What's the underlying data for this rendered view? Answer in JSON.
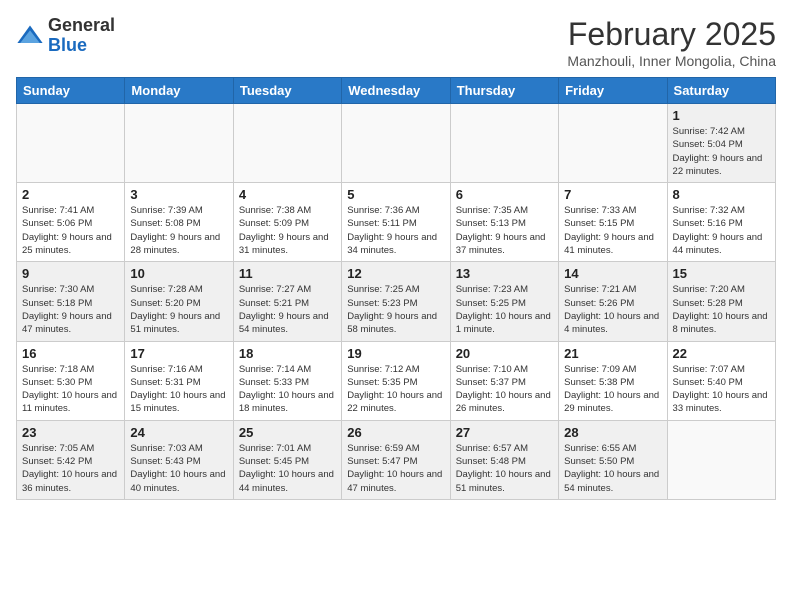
{
  "logo": {
    "general": "General",
    "blue": "Blue"
  },
  "title": "February 2025",
  "location": "Manzhouli, Inner Mongolia, China",
  "weekdays": [
    "Sunday",
    "Monday",
    "Tuesday",
    "Wednesday",
    "Thursday",
    "Friday",
    "Saturday"
  ],
  "weeks": [
    [
      {
        "day": "",
        "info": ""
      },
      {
        "day": "",
        "info": ""
      },
      {
        "day": "",
        "info": ""
      },
      {
        "day": "",
        "info": ""
      },
      {
        "day": "",
        "info": ""
      },
      {
        "day": "",
        "info": ""
      },
      {
        "day": "1",
        "info": "Sunrise: 7:42 AM\nSunset: 5:04 PM\nDaylight: 9 hours and 22 minutes."
      }
    ],
    [
      {
        "day": "2",
        "info": "Sunrise: 7:41 AM\nSunset: 5:06 PM\nDaylight: 9 hours and 25 minutes."
      },
      {
        "day": "3",
        "info": "Sunrise: 7:39 AM\nSunset: 5:08 PM\nDaylight: 9 hours and 28 minutes."
      },
      {
        "day": "4",
        "info": "Sunrise: 7:38 AM\nSunset: 5:09 PM\nDaylight: 9 hours and 31 minutes."
      },
      {
        "day": "5",
        "info": "Sunrise: 7:36 AM\nSunset: 5:11 PM\nDaylight: 9 hours and 34 minutes."
      },
      {
        "day": "6",
        "info": "Sunrise: 7:35 AM\nSunset: 5:13 PM\nDaylight: 9 hours and 37 minutes."
      },
      {
        "day": "7",
        "info": "Sunrise: 7:33 AM\nSunset: 5:15 PM\nDaylight: 9 hours and 41 minutes."
      },
      {
        "day": "8",
        "info": "Sunrise: 7:32 AM\nSunset: 5:16 PM\nDaylight: 9 hours and 44 minutes."
      }
    ],
    [
      {
        "day": "9",
        "info": "Sunrise: 7:30 AM\nSunset: 5:18 PM\nDaylight: 9 hours and 47 minutes."
      },
      {
        "day": "10",
        "info": "Sunrise: 7:28 AM\nSunset: 5:20 PM\nDaylight: 9 hours and 51 minutes."
      },
      {
        "day": "11",
        "info": "Sunrise: 7:27 AM\nSunset: 5:21 PM\nDaylight: 9 hours and 54 minutes."
      },
      {
        "day": "12",
        "info": "Sunrise: 7:25 AM\nSunset: 5:23 PM\nDaylight: 9 hours and 58 minutes."
      },
      {
        "day": "13",
        "info": "Sunrise: 7:23 AM\nSunset: 5:25 PM\nDaylight: 10 hours and 1 minute."
      },
      {
        "day": "14",
        "info": "Sunrise: 7:21 AM\nSunset: 5:26 PM\nDaylight: 10 hours and 4 minutes."
      },
      {
        "day": "15",
        "info": "Sunrise: 7:20 AM\nSunset: 5:28 PM\nDaylight: 10 hours and 8 minutes."
      }
    ],
    [
      {
        "day": "16",
        "info": "Sunrise: 7:18 AM\nSunset: 5:30 PM\nDaylight: 10 hours and 11 minutes."
      },
      {
        "day": "17",
        "info": "Sunrise: 7:16 AM\nSunset: 5:31 PM\nDaylight: 10 hours and 15 minutes."
      },
      {
        "day": "18",
        "info": "Sunrise: 7:14 AM\nSunset: 5:33 PM\nDaylight: 10 hours and 18 minutes."
      },
      {
        "day": "19",
        "info": "Sunrise: 7:12 AM\nSunset: 5:35 PM\nDaylight: 10 hours and 22 minutes."
      },
      {
        "day": "20",
        "info": "Sunrise: 7:10 AM\nSunset: 5:37 PM\nDaylight: 10 hours and 26 minutes."
      },
      {
        "day": "21",
        "info": "Sunrise: 7:09 AM\nSunset: 5:38 PM\nDaylight: 10 hours and 29 minutes."
      },
      {
        "day": "22",
        "info": "Sunrise: 7:07 AM\nSunset: 5:40 PM\nDaylight: 10 hours and 33 minutes."
      }
    ],
    [
      {
        "day": "23",
        "info": "Sunrise: 7:05 AM\nSunset: 5:42 PM\nDaylight: 10 hours and 36 minutes."
      },
      {
        "day": "24",
        "info": "Sunrise: 7:03 AM\nSunset: 5:43 PM\nDaylight: 10 hours and 40 minutes."
      },
      {
        "day": "25",
        "info": "Sunrise: 7:01 AM\nSunset: 5:45 PM\nDaylight: 10 hours and 44 minutes."
      },
      {
        "day": "26",
        "info": "Sunrise: 6:59 AM\nSunset: 5:47 PM\nDaylight: 10 hours and 47 minutes."
      },
      {
        "day": "27",
        "info": "Sunrise: 6:57 AM\nSunset: 5:48 PM\nDaylight: 10 hours and 51 minutes."
      },
      {
        "day": "28",
        "info": "Sunrise: 6:55 AM\nSunset: 5:50 PM\nDaylight: 10 hours and 54 minutes."
      },
      {
        "day": "",
        "info": ""
      }
    ]
  ]
}
